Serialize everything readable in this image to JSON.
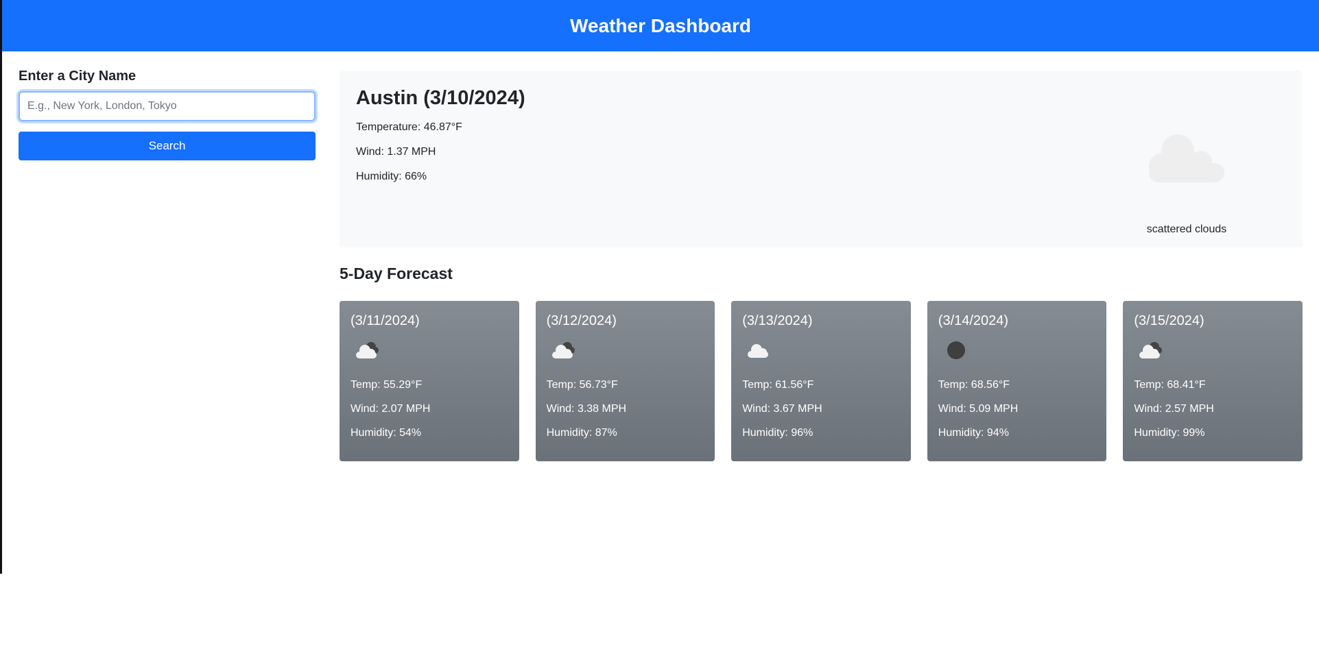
{
  "header": {
    "title": "Weather Dashboard"
  },
  "search": {
    "label": "Enter a City Name",
    "placeholder": "E.g., New York, London, Tokyo",
    "value": "",
    "button_label": "Search"
  },
  "current": {
    "heading": "Austin (3/10/2024)",
    "temperature": "Temperature: 46.87°F",
    "wind": "Wind: 1.37 MPH",
    "humidity": "Humidity: 66%",
    "icon": "cloud-icon",
    "description": "scattered clouds"
  },
  "forecast": {
    "title": "5-Day Forecast",
    "days": [
      {
        "date": "(3/11/2024)",
        "icon": "cloud-dark-icon",
        "temp": "Temp: 55.29°F",
        "wind": "Wind: 2.07 MPH",
        "humidity": "Humidity: 54%"
      },
      {
        "date": "(3/12/2024)",
        "icon": "cloud-dark-icon",
        "temp": "Temp: 56.73°F",
        "wind": "Wind: 3.38 MPH",
        "humidity": "Humidity: 87%"
      },
      {
        "date": "(3/13/2024)",
        "icon": "cloud-icon",
        "temp": "Temp: 61.56°F",
        "wind": "Wind: 3.67 MPH",
        "humidity": "Humidity: 96%"
      },
      {
        "date": "(3/14/2024)",
        "icon": "dark-circle-icon",
        "temp": "Temp: 68.56°F",
        "wind": "Wind: 5.09 MPH",
        "humidity": "Humidity: 94%"
      },
      {
        "date": "(3/15/2024)",
        "icon": "cloud-dark-icon",
        "temp": "Temp: 68.41°F",
        "wind": "Wind: 2.57 MPH",
        "humidity": "Humidity: 99%"
      }
    ]
  },
  "colors": {
    "header_bg": "#1570fd",
    "card_bg_top": "#858c93",
    "card_bg_bottom": "#6a7179",
    "current_bg": "#f8f9fa"
  }
}
